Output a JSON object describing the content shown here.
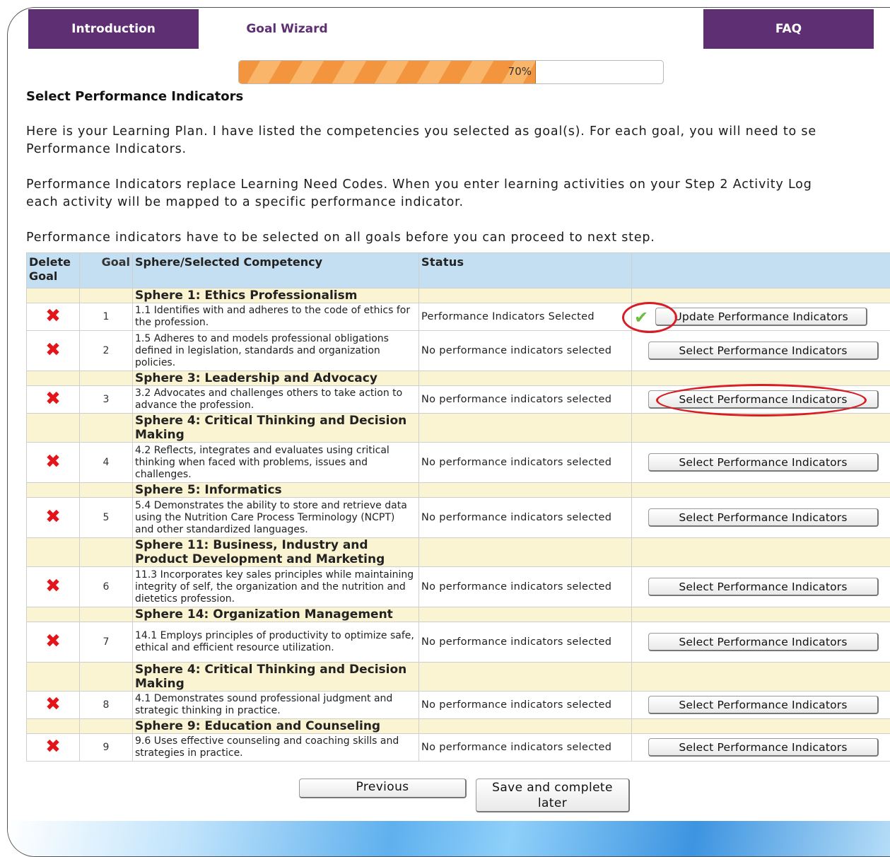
{
  "tabs": {
    "introduction": "Introduction",
    "goal_wizard": "Goal Wizard",
    "faq": "FAQ"
  },
  "progress": {
    "value": 70,
    "label": "70%"
  },
  "heading": "Select Performance Indicators",
  "paragraphs": [
    "Here is your Learning Plan.  I have listed the competencies you selected as goal(s).  For each goal, you will need to se\nPerformance Indicators.",
    "Performance Indicators replace Learning Need Codes.  When you enter learning activities on your Step 2 Activity Log\neach activity will be mapped to a specific performance indicator.",
    "Performance indicators have to be selected on all goals before you can proceed to next step."
  ],
  "table": {
    "headers": [
      "Delete Goal",
      "Goal",
      "Sphere/Selected Competency",
      "Status",
      ""
    ],
    "rows": [
      {
        "type": "sphere",
        "label": "Sphere 1: Ethics Professionalism"
      },
      {
        "type": "goal",
        "num": "1",
        "competency": "1.1 Identifies with and adheres to the code of ethics for the profession.",
        "status": "Performance Indicators Selected",
        "action": "Update Performance Indicators",
        "checked": true
      },
      {
        "type": "goal",
        "num": "2",
        "competency": "1.5 Adheres to and models professional obligations defined in legislation, standards and organization policies.",
        "status": "No performance indicators selected",
        "action": "Select Performance Indicators"
      },
      {
        "type": "sphere",
        "label": "Sphere 3: Leadership and Advocacy"
      },
      {
        "type": "goal",
        "num": "3",
        "competency": "3.2 Advocates and challenges others to take action to advance the profession.",
        "status": "No performance indicators selected",
        "action": "Select Performance Indicators",
        "highlighted": true
      },
      {
        "type": "sphere",
        "label": "Sphere 4: Critical Thinking and Decision Making"
      },
      {
        "type": "goal",
        "num": "4",
        "competency": "4.2 Reflects, integrates and evaluates using critical thinking when faced with problems, issues and challenges.",
        "status": "No performance indicators selected",
        "action": "Select Performance Indicators"
      },
      {
        "type": "sphere",
        "label": "Sphere 5: Informatics"
      },
      {
        "type": "goal",
        "num": "5",
        "competency": "5.4 Demonstrates the ability to store and retrieve data using the Nutrition Care Process Terminology (NCPT) and other standardized languages.",
        "status": "No performance indicators selected",
        "action": "Select Performance Indicators"
      },
      {
        "type": "sphere",
        "label": "Sphere 11: Business, Industry and Product Development and Marketing"
      },
      {
        "type": "goal",
        "num": "6",
        "competency": "11.3 Incorporates key sales principles while maintaining integrity of self, the organization and the nutrition and dietetics profession.",
        "status": "No performance indicators selected",
        "action": "Select Performance Indicators"
      },
      {
        "type": "sphere",
        "label": "Sphere 14: Organization Management"
      },
      {
        "type": "goal",
        "num": "7",
        "competency": "14.1 Employs principles of productivity to optimize safe, ethical and efficient resource utilization.",
        "status": "No performance indicators selected",
        "action": "Select Performance Indicators"
      },
      {
        "type": "sphere",
        "label": "Sphere 4: Critical Thinking and Decision Making"
      },
      {
        "type": "goal",
        "num": "8",
        "competency": "4.1 Demonstrates sound professional judgment and strategic thinking in practice.",
        "status": "No performance indicators selected",
        "action": "Select Performance Indicators"
      },
      {
        "type": "sphere",
        "label": "Sphere 9: Education and Counseling"
      },
      {
        "type": "goal",
        "num": "9",
        "competency": "9.6 Uses effective counseling and coaching skills and strategies in practice.",
        "status": "No performance indicators selected",
        "action": "Select Performance Indicators"
      }
    ]
  },
  "buttons": {
    "previous": "Previous",
    "save_later": "Save and complete later"
  },
  "colors": {
    "tab_purple": "#5e2f72",
    "progress_orange": "#f2953e",
    "header_blue": "#c5dff2",
    "sphere_yellow": "#fbf4d3",
    "delete_red": "#e3151a",
    "check_green": "#6cbe3a",
    "annotation_red": "#d81d25"
  }
}
